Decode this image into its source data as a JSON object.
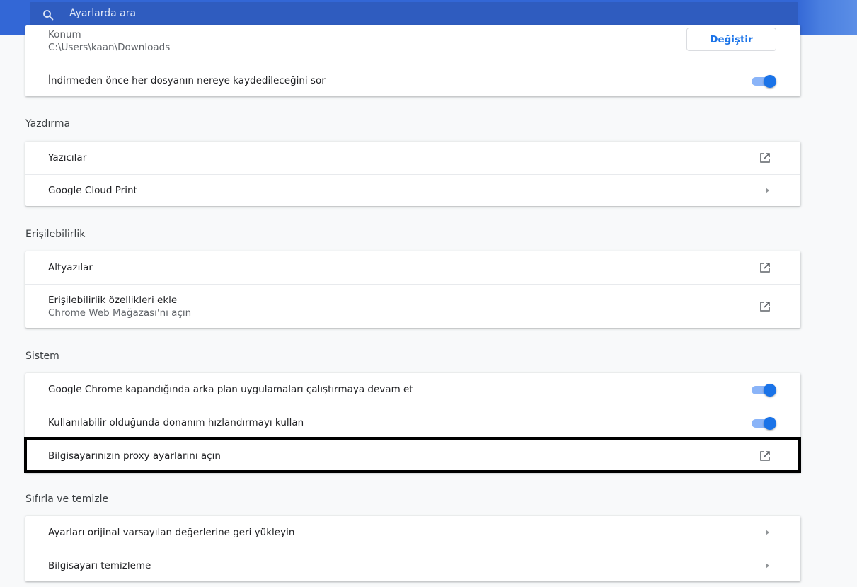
{
  "search": {
    "placeholder": "Ayarlarda ara"
  },
  "downloads": {
    "location_label": "Konum",
    "location_path": "C:\\Users\\kaan\\Downloads",
    "change_button": "Değiştir",
    "ask_where": {
      "label": "İndirmeden önce her dosyanın nereye kaydedileceğini sor",
      "enabled": true
    }
  },
  "printing": {
    "title": "Yazdırma",
    "items": [
      {
        "label": "Yazıcılar",
        "action": "external-link-icon"
      },
      {
        "label": "Google Cloud Print",
        "action": "chevron-right-icon"
      }
    ]
  },
  "accessibility": {
    "title": "Erişilebilirlik",
    "items": [
      {
        "label": "Altyazılar",
        "action": "external-link-icon"
      },
      {
        "label": "Erişilebilirlik özellikleri ekle",
        "sublabel": "Chrome Web Mağazası'nı açın",
        "action": "external-link-icon"
      }
    ]
  },
  "system": {
    "title": "Sistem",
    "items": [
      {
        "label": "Google Chrome kapandığında arka plan uygulamaları çalıştırmaya devam et",
        "enabled": true
      },
      {
        "label": "Kullanılabilir olduğunda donanım hızlandırmayı kullan",
        "enabled": true
      },
      {
        "label": "Bilgisayarınızın proxy ayarlarını açın",
        "action": "external-link-icon"
      }
    ]
  },
  "reset": {
    "title": "Sıfırla ve temizle",
    "items": [
      {
        "label": "Ayarları orijinal varsayılan değerlerine geri yükleyin",
        "action": "chevron-right-icon"
      },
      {
        "label": "Bilgisayarı temizleme",
        "action": "chevron-right-icon"
      }
    ]
  },
  "colors": {
    "accent": "#1a73e8",
    "toolbar": "#3367d6",
    "highlight_border": "#000000"
  }
}
